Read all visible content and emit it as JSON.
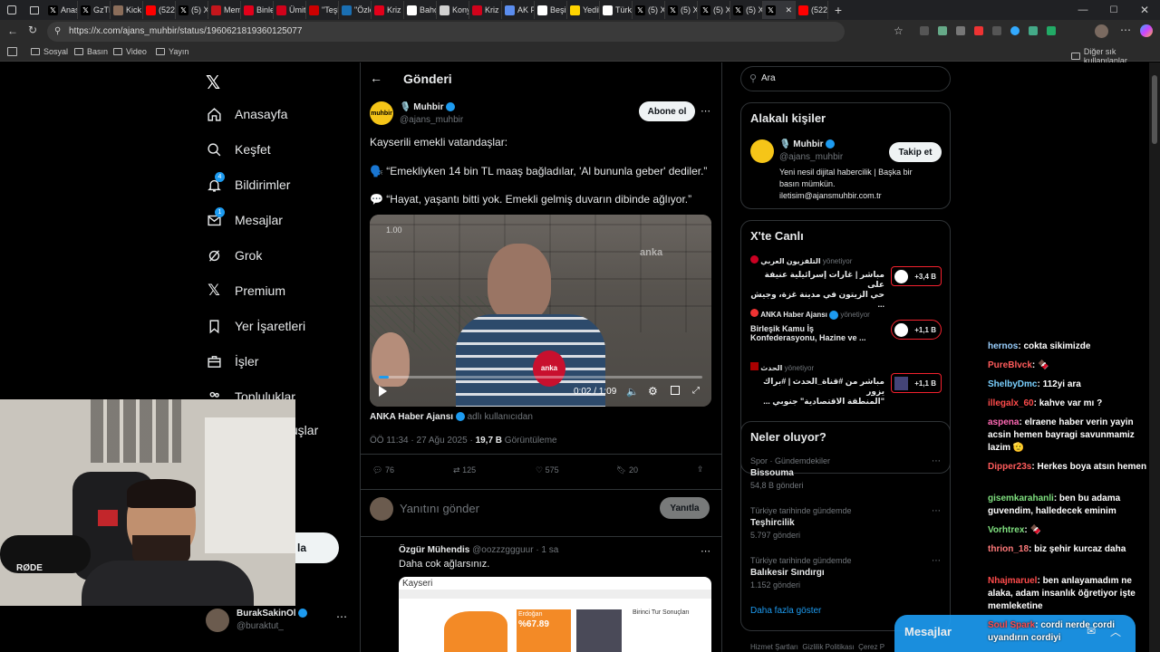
{
  "browser": {
    "tabs": [
      {
        "label": "Anasa",
        "icon": "x-icon",
        "color": "#000000"
      },
      {
        "label": "GzTKb",
        "icon": "x-icon",
        "color": "#000000"
      },
      {
        "label": "Kick Li",
        "icon": "avatar",
        "color": "#8a6d5a"
      },
      {
        "label": "(522)",
        "icon": "youtube-icon",
        "color": "#ff0000"
      },
      {
        "label": "(5) X'i",
        "icon": "x-icon",
        "color": "#000000"
      },
      {
        "label": "Memu",
        "icon": "news-icon",
        "color": "#c4161c"
      },
      {
        "label": "Binler",
        "icon": "news-icon",
        "color": "#e2001a"
      },
      {
        "label": "Ümit",
        "icon": "c-icon",
        "color": "#d0021b"
      },
      {
        "label": "\"Teşhi",
        "icon": "news-icon",
        "color": "#cc0000"
      },
      {
        "label": "\"Özle",
        "icon": "trt-icon",
        "color": "#1a6fb3"
      },
      {
        "label": "Kriz w",
        "icon": "n-icon",
        "color": "#e2001a"
      },
      {
        "label": "Bahçe",
        "icon": "news-icon",
        "color": "#ffffff"
      },
      {
        "label": "Konya",
        "icon": "news-icon",
        "color": "#d0d0d0"
      },
      {
        "label": "Kriz di",
        "icon": "k-icon",
        "color": "#d0021b"
      },
      {
        "label": "AK Pa",
        "icon": "globe-icon",
        "color": "#5b8def"
      },
      {
        "label": "Beşikt",
        "icon": "news-icon",
        "color": "#ffffff"
      },
      {
        "label": "Yedik",
        "icon": "y-icon",
        "color": "#ffd400"
      },
      {
        "label": "Türkiy",
        "icon": "news-icon",
        "color": "#ffffff"
      },
      {
        "label": "(5) X'i",
        "icon": "x-icon",
        "color": "#000000"
      },
      {
        "label": "(5) X'i",
        "icon": "x-icon",
        "color": "#000000"
      },
      {
        "label": "(5) X'i",
        "icon": "x-icon",
        "color": "#000000"
      },
      {
        "label": "(5) X'i",
        "icon": "x-icon",
        "color": "#000000"
      },
      {
        "label": "",
        "icon": "x-icon",
        "color": "#000000"
      },
      {
        "label": "(522)",
        "icon": "youtube-icon",
        "color": "#ff0000"
      }
    ],
    "url": "https://x.com/ajans_muhbir/status/1960621819360125077",
    "bookmarks": [
      "Sosyal",
      "Basın",
      "Video",
      "Yayın"
    ],
    "other_bookmarks": "Diğer sık kullanılanlar"
  },
  "sidebar": {
    "items": [
      {
        "label": "Anasayfa",
        "icon": "home-icon"
      },
      {
        "label": "Keşfet",
        "icon": "search-icon"
      },
      {
        "label": "Bildirimler",
        "icon": "bell-icon",
        "badge": "4"
      },
      {
        "label": "Mesajlar",
        "icon": "mail-icon",
        "badge": "1"
      },
      {
        "label": "Grok",
        "icon": "grok-icon"
      },
      {
        "label": "Premium",
        "icon": "x-icon"
      },
      {
        "label": "Yer İşaretleri",
        "icon": "bookmark-icon"
      },
      {
        "label": "İşler",
        "icon": "briefcase-icon"
      },
      {
        "label": "Topluluklar",
        "icon": "people-icon"
      },
      {
        "label": "uluşlar",
        "icon": "lightning-icon"
      }
    ],
    "post_button": "la",
    "account": {
      "name": "BurakSakinOl",
      "handle": "@buraktut_"
    }
  },
  "post": {
    "header_title": "Gönderi",
    "author": {
      "name": "Muhbir",
      "handle": "@ajans_muhbir",
      "avatar_text": "muhbir"
    },
    "subscribe": "Abone ol",
    "text_lines": [
      "Kayserili emekli vatandaşlar:",
      "“Emekliyken 14 bin TL maaş bağladılar, 'Al bununla geber' dediler.”",
      "“Hayat, yaşantı bitti yok. Emekli gelmiş duvarın dibinde ağlıyor.”"
    ],
    "video": {
      "speed": "1.00",
      "time": "0:02 / 1:09",
      "watermark": "anka",
      "progress": 0.03
    },
    "source": {
      "name": "ANKA Haber Ajansı",
      "suffix": "adlı kullanıcıdan"
    },
    "meta": {
      "time": "ÖÖ 11:34 · 27 Ağu 2025 · ",
      "views": "19,7 B",
      "views_label": " Görüntüleme"
    },
    "stats": {
      "replies": "76",
      "reposts": "125",
      "likes": "575",
      "bookmarks": "20"
    },
    "reply_placeholder": "Yanıtını gönder",
    "reply_button": "Yanıtla"
  },
  "reply": {
    "name": "Özgür Mühendis",
    "handle": "@oozzzggguur · 1 sa",
    "text": "Daha cok ağlarsınız.",
    "image_title": "Kayseri",
    "image_label": "Erdoğan",
    "image_pct": "%67.89",
    "image_box": "Birinci Tur Sonuçları"
  },
  "right": {
    "search_placeholder": "Ara",
    "related_title": "Alakalı kişiler",
    "related": {
      "name": "Muhbir",
      "handle": "@ajans_muhbir",
      "follow": "Takip et",
      "bio": [
        "Yeni nesil dijital habercilik | Başka bir",
        "basın mümkün.",
        "iletisim@ajansmuhbir.com.tr"
      ]
    },
    "live_title": "X'te Canlı",
    "live": [
      {
        "source": "التلفزيون العربي",
        "status": "yönetiyor",
        "title": "مباشر | غارات إسرائيلية عنيفة على",
        "title2": "حي الزيتون في مدينة غزة، وجيش ...",
        "count": "+3,4 B"
      },
      {
        "source": "ANKA Haber Ajansı",
        "status": "yönetiyor",
        "title": "Birleşik Kamu İş",
        "title2": "Konfederasyonu, Hazine ve ...",
        "count": "+1,1 B"
      },
      {
        "source": "الحدث",
        "status": "yönetiyor",
        "title": "مباشر من #قناة_الحدث | #براك يزور",
        "title2": "\"المنطقة الاقتصادية\" جنوبي ...",
        "count": "+1,1 B"
      }
    ],
    "trends_title": "Neler oluyor?",
    "trends": [
      {
        "context": "Spor · Gündemdekiler",
        "name": "Bissouma",
        "count": "54,8 B gönderi"
      },
      {
        "context": "Türkiye tarihinde gündemde",
        "name": "Teşhircilik",
        "count": "5.797 gönderi"
      },
      {
        "context": "Türkiye tarihinde gündemde",
        "name": "Balıkesir Sındırgı",
        "count": "1.152 gönderi"
      }
    ],
    "show_more": "Daha fazla göster",
    "footer": "Hizmet Şartları  Gizlilik Politikası  Çerez P"
  },
  "messages_bar": {
    "label": "Mesajlar"
  },
  "chat": [
    {
      "user": "hernos",
      "msg": "cokta sikimizde",
      "color": "#9ad0ff"
    },
    {
      "user": "PureBlvck",
      "msg": "🍫",
      "color": "#ff5b5b"
    },
    {
      "user": "ShelbyDmc",
      "msg": "112yi ara",
      "color": "#7ad0ff"
    },
    {
      "user": "illegalx_60",
      "msg": "kahve var mı ?",
      "color": "#ff4b4b"
    },
    {
      "user": "aspena",
      "msg": "elraene haber verin yayin acsin hemen bayragi savunmamiz lazim 🫡",
      "color": "#ff69b4"
    },
    {
      "user": "Dipper23s",
      "msg": "Herkes boya atsın hemen",
      "color": "#ff5b5b"
    },
    {
      "user": "gisemkarahanli",
      "msg": "ben bu adama guvendim, halledecek eminim",
      "color": "#7fe07f"
    },
    {
      "user": "Vorhtrex",
      "msg": "🍫",
      "color": "#7fe07f"
    },
    {
      "user": "thrion_18",
      "msg": "biz şehir kurcaz daha",
      "color": "#ff7a7a"
    },
    {
      "user": "Nhajmaruel",
      "msg": "ben anlayamadım ne alaka, adam insanlık öğretiyor işte memleketine",
      "color": "#ff4b4b"
    },
    {
      "user": "Soul Spark",
      "msg": "cordi nerde cordi uyandırın cordiyi",
      "color": "#ff4b4b"
    }
  ],
  "webcam": {
    "brand": "RØDE"
  }
}
